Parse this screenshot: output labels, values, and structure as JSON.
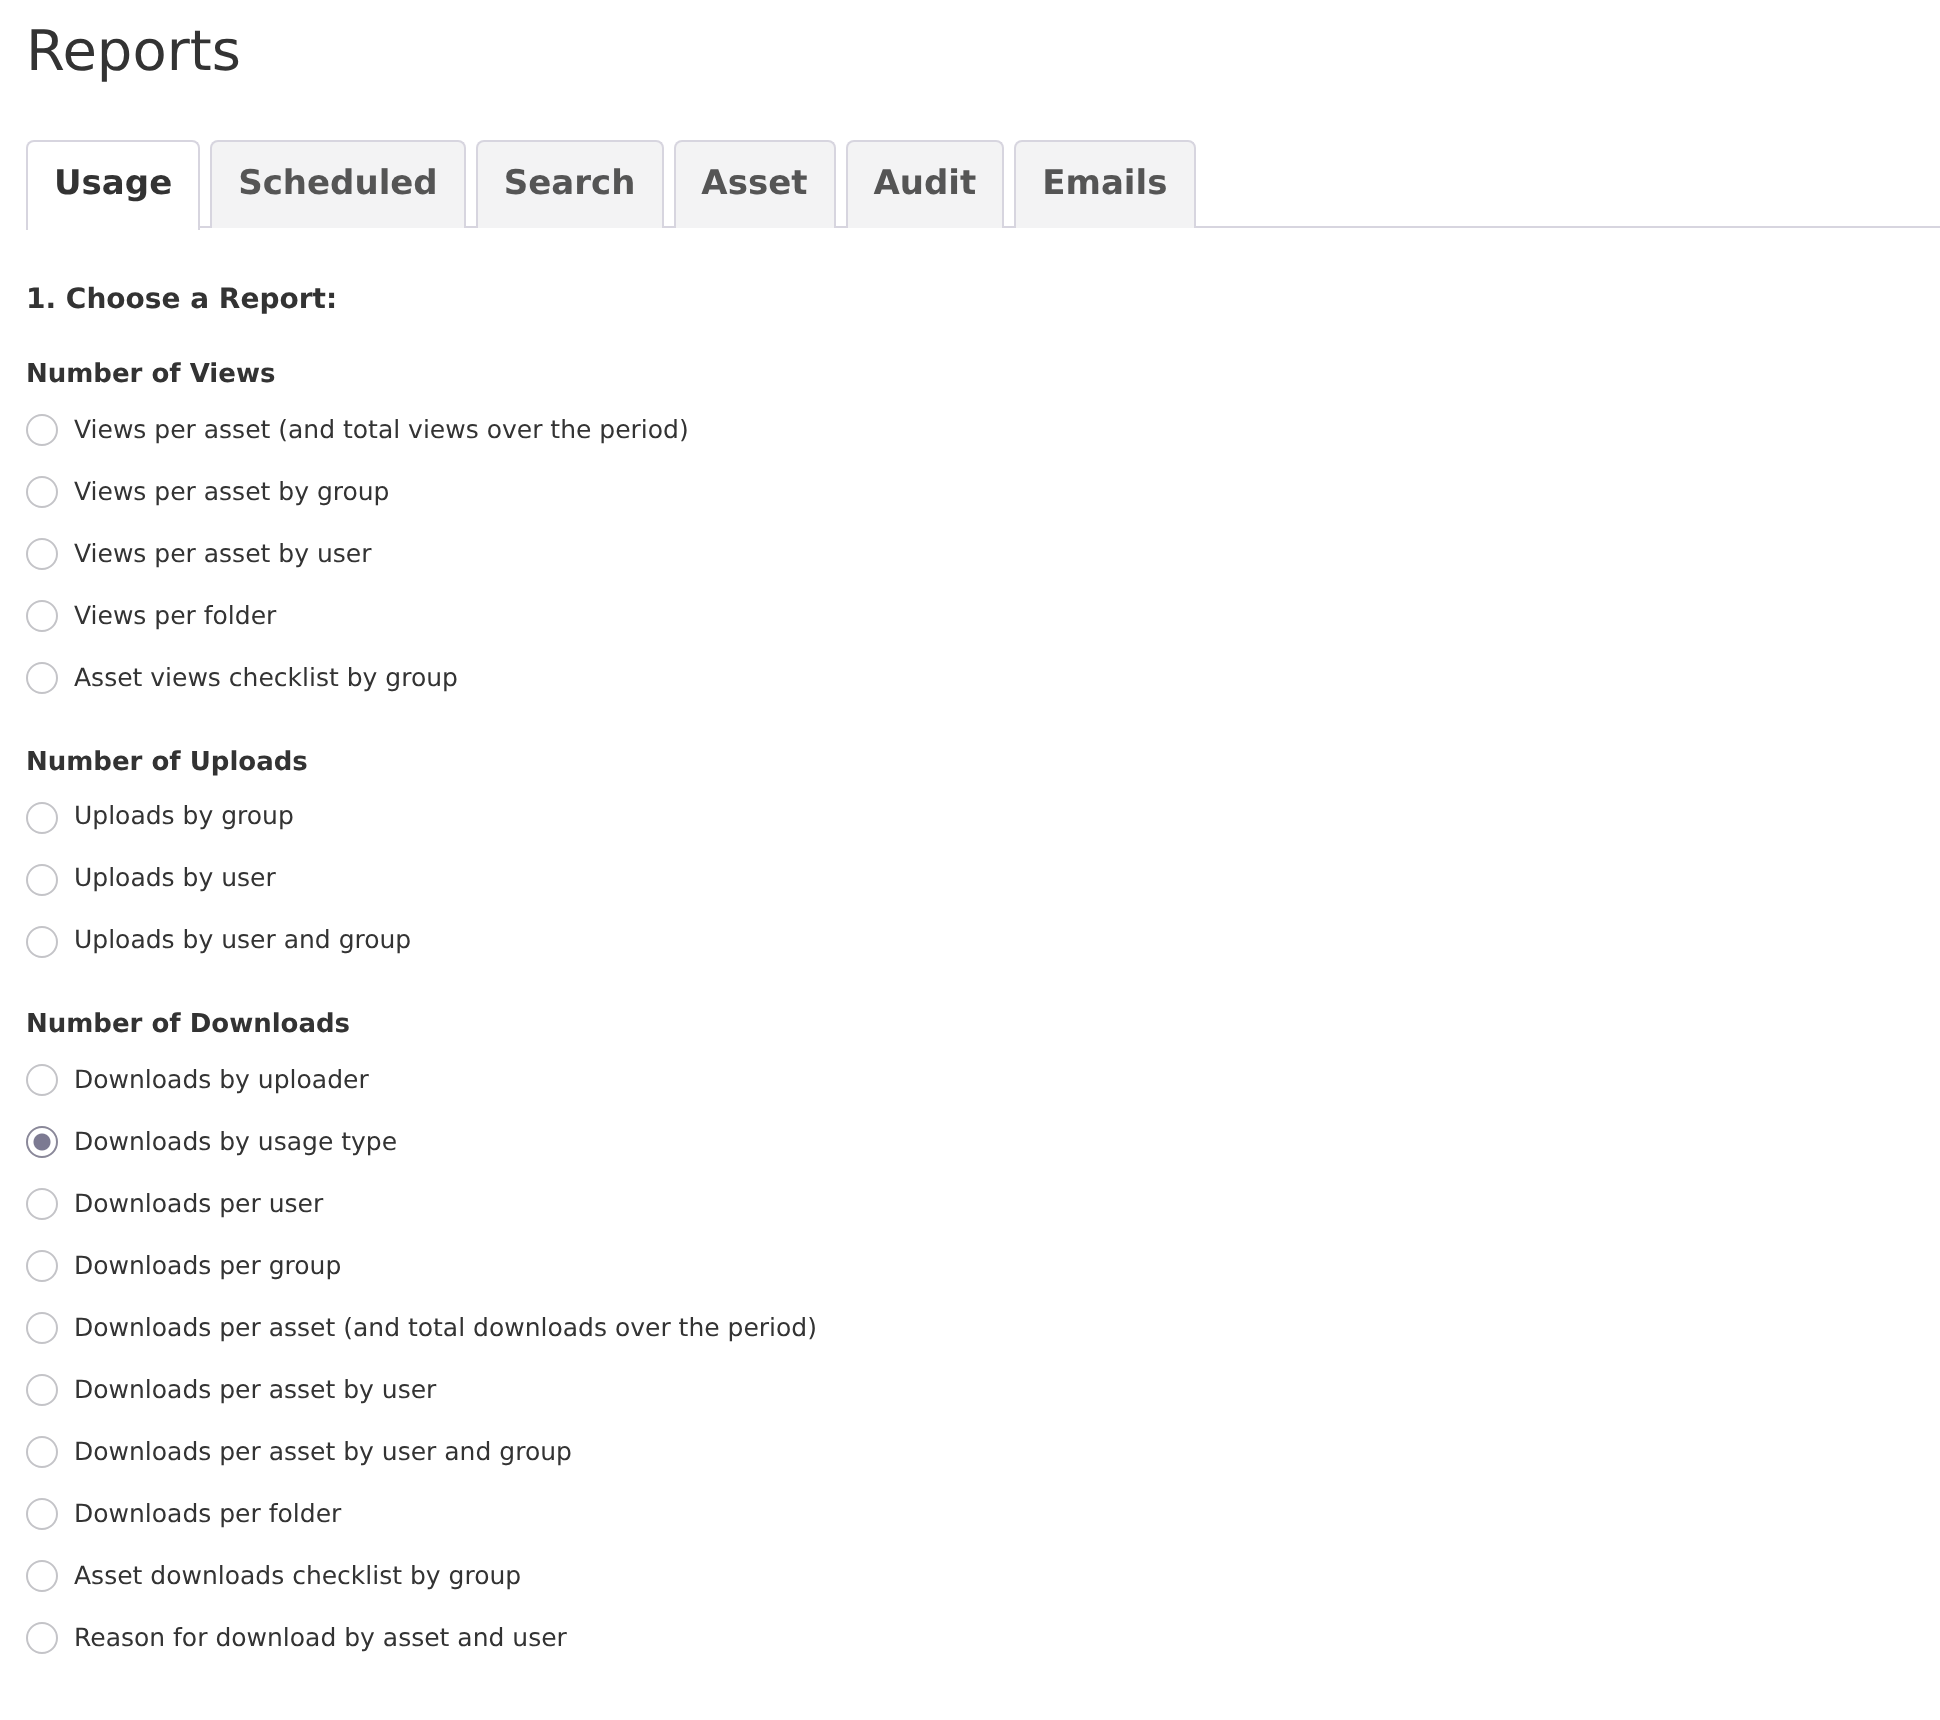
{
  "page_title": "Reports",
  "tabs": [
    {
      "label": "Usage",
      "selected": true
    },
    {
      "label": "Scheduled",
      "selected": false
    },
    {
      "label": "Search",
      "selected": false
    },
    {
      "label": "Asset",
      "selected": false
    },
    {
      "label": "Audit",
      "selected": false
    },
    {
      "label": "Emails",
      "selected": false
    }
  ],
  "step_heading": "1. Choose a Report:",
  "groups": [
    {
      "heading": "Number of Views",
      "options": [
        {
          "label": "Views per asset (and total views over the period)",
          "selected": false
        },
        {
          "label": "Views per asset by group",
          "selected": false
        },
        {
          "label": "Views per asset by user",
          "selected": false
        },
        {
          "label": "Views per folder",
          "selected": false
        },
        {
          "label": "Asset views checklist by group",
          "selected": false
        }
      ]
    },
    {
      "heading": "Number of Uploads",
      "options": [
        {
          "label": "Uploads by group",
          "selected": false
        },
        {
          "label": "Uploads by user",
          "selected": false
        },
        {
          "label": "Uploads by user and group",
          "selected": false
        }
      ]
    },
    {
      "heading": "Number of Downloads",
      "options": [
        {
          "label": "Downloads by uploader",
          "selected": false
        },
        {
          "label": "Downloads by usage type",
          "selected": true
        },
        {
          "label": "Downloads per user",
          "selected": false
        },
        {
          "label": "Downloads per group",
          "selected": false
        },
        {
          "label": "Downloads per asset (and total downloads over the period)",
          "selected": false
        },
        {
          "label": "Downloads per asset by user",
          "selected": false
        },
        {
          "label": "Downloads per asset by user and group",
          "selected": false
        },
        {
          "label": "Downloads per folder",
          "selected": false
        },
        {
          "label": "Asset downloads checklist by group",
          "selected": false
        },
        {
          "label": "Reason for download by asset and user",
          "selected": false
        }
      ]
    }
  ]
}
